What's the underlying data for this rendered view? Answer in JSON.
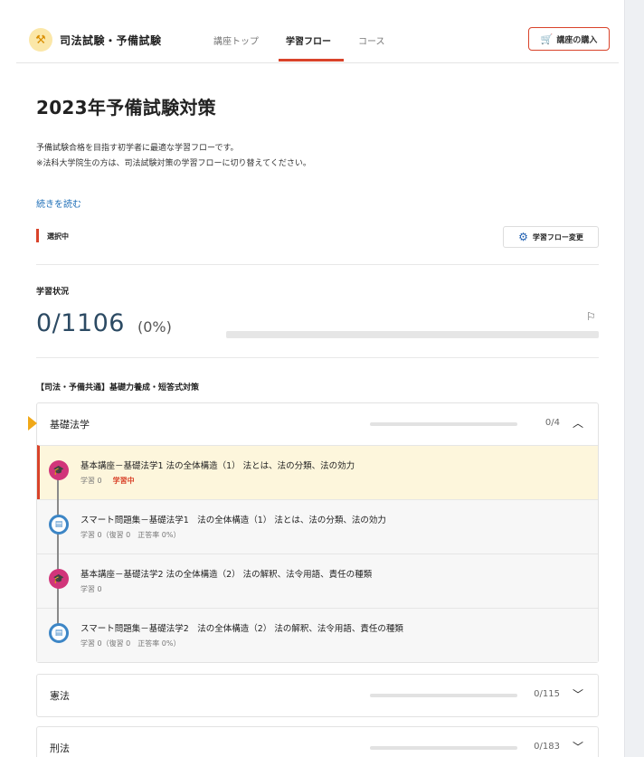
{
  "header": {
    "brand": "司法試験・予備試験",
    "tabs": [
      {
        "label": "講座トップ"
      },
      {
        "label": "学習フロー"
      },
      {
        "label": "コース"
      }
    ],
    "buy_label": "講座の購入"
  },
  "main": {
    "title": "2023年予備試験対策",
    "desc_line1": "予備試験合格を目指す初学者に最適な学習フローです。",
    "desc_line2": "※法科大学院生の方は、司法試験対策の学習フローに切り替えてください。",
    "read_more": "続きを読む",
    "selected_label": "選択中",
    "flow_change_label": "学習フロー変更",
    "status_label": "学習状況",
    "progress_count": "0/1106",
    "progress_percent": "(0%)",
    "progress_fraction": 0,
    "section_title": "【司法・予備共通】基礎力養成・短答式対策"
  },
  "accordions": [
    {
      "title": "基礎法学",
      "count": "0/4",
      "progress": 0,
      "expanded": true,
      "lessons": [
        {
          "type": "video",
          "title": "基本講座－基礎法学1 法の全体構造（1） 法とは、法の分類、法の効力",
          "meta": "学習 0",
          "status": "学習中"
        },
        {
          "type": "doc",
          "title": "スマート問題集－基礎法学1　法の全体構造（1） 法とは、法の分類、法の効力",
          "meta": "学習 0（復習 0　正答率 0%）",
          "status": ""
        },
        {
          "type": "video",
          "title": "基本講座－基礎法学2 法の全体構造（2） 法の解釈、法令用語、責任の種類",
          "meta": "学習 0",
          "status": ""
        },
        {
          "type": "doc",
          "title": "スマート問題集－基礎法学2　法の全体構造（2） 法の解釈、法令用語、責任の種類",
          "meta": "学習 0（復習 0　正答率 0%）",
          "status": ""
        }
      ]
    },
    {
      "title": "憲法",
      "count": "0/115",
      "progress": 0,
      "expanded": false
    },
    {
      "title": "刑法",
      "count": "0/183",
      "progress": 0,
      "expanded": false
    }
  ],
  "colors": {
    "accent": "#d9432a",
    "progress": "#2c4a63",
    "link": "#1f6fb7",
    "current_bg": "#fdf6dc",
    "video_icon": "#d1357a",
    "doc_icon": "#3d86c6"
  }
}
